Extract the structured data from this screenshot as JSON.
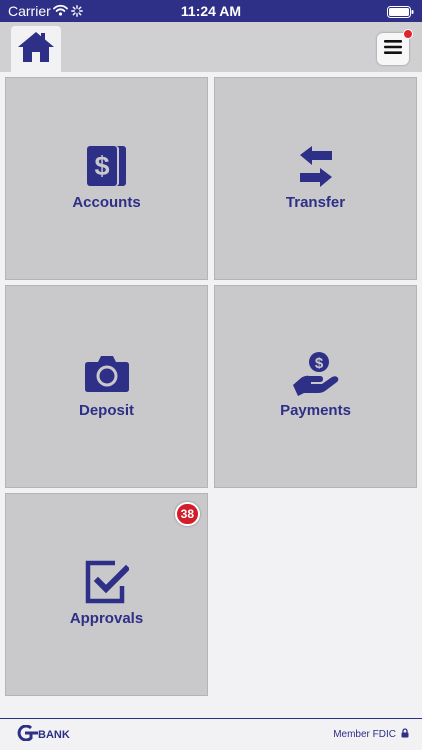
{
  "status_bar": {
    "carrier": "Carrier",
    "time": "11:24 AM"
  },
  "header": {
    "home_icon": "home-icon",
    "menu_icon": "hamburger-menu-icon",
    "menu_notification": true
  },
  "tiles": [
    {
      "label": "Accounts",
      "icon": "accounts-dollar-cards-icon"
    },
    {
      "label": "Transfer",
      "icon": "transfer-arrows-icon"
    },
    {
      "label": "Deposit",
      "icon": "camera-icon"
    },
    {
      "label": "Payments",
      "icon": "hand-coin-icon"
    },
    {
      "label": "Approvals",
      "icon": "checkbox-icon",
      "badge": "38"
    }
  ],
  "footer": {
    "logo_text": "BANK",
    "member_text": "Member FDIC"
  },
  "colors": {
    "brand": "#2e2f86",
    "tile": "#c9c9cb",
    "badge": "#d21e2b",
    "background": "#f2f2f4"
  }
}
